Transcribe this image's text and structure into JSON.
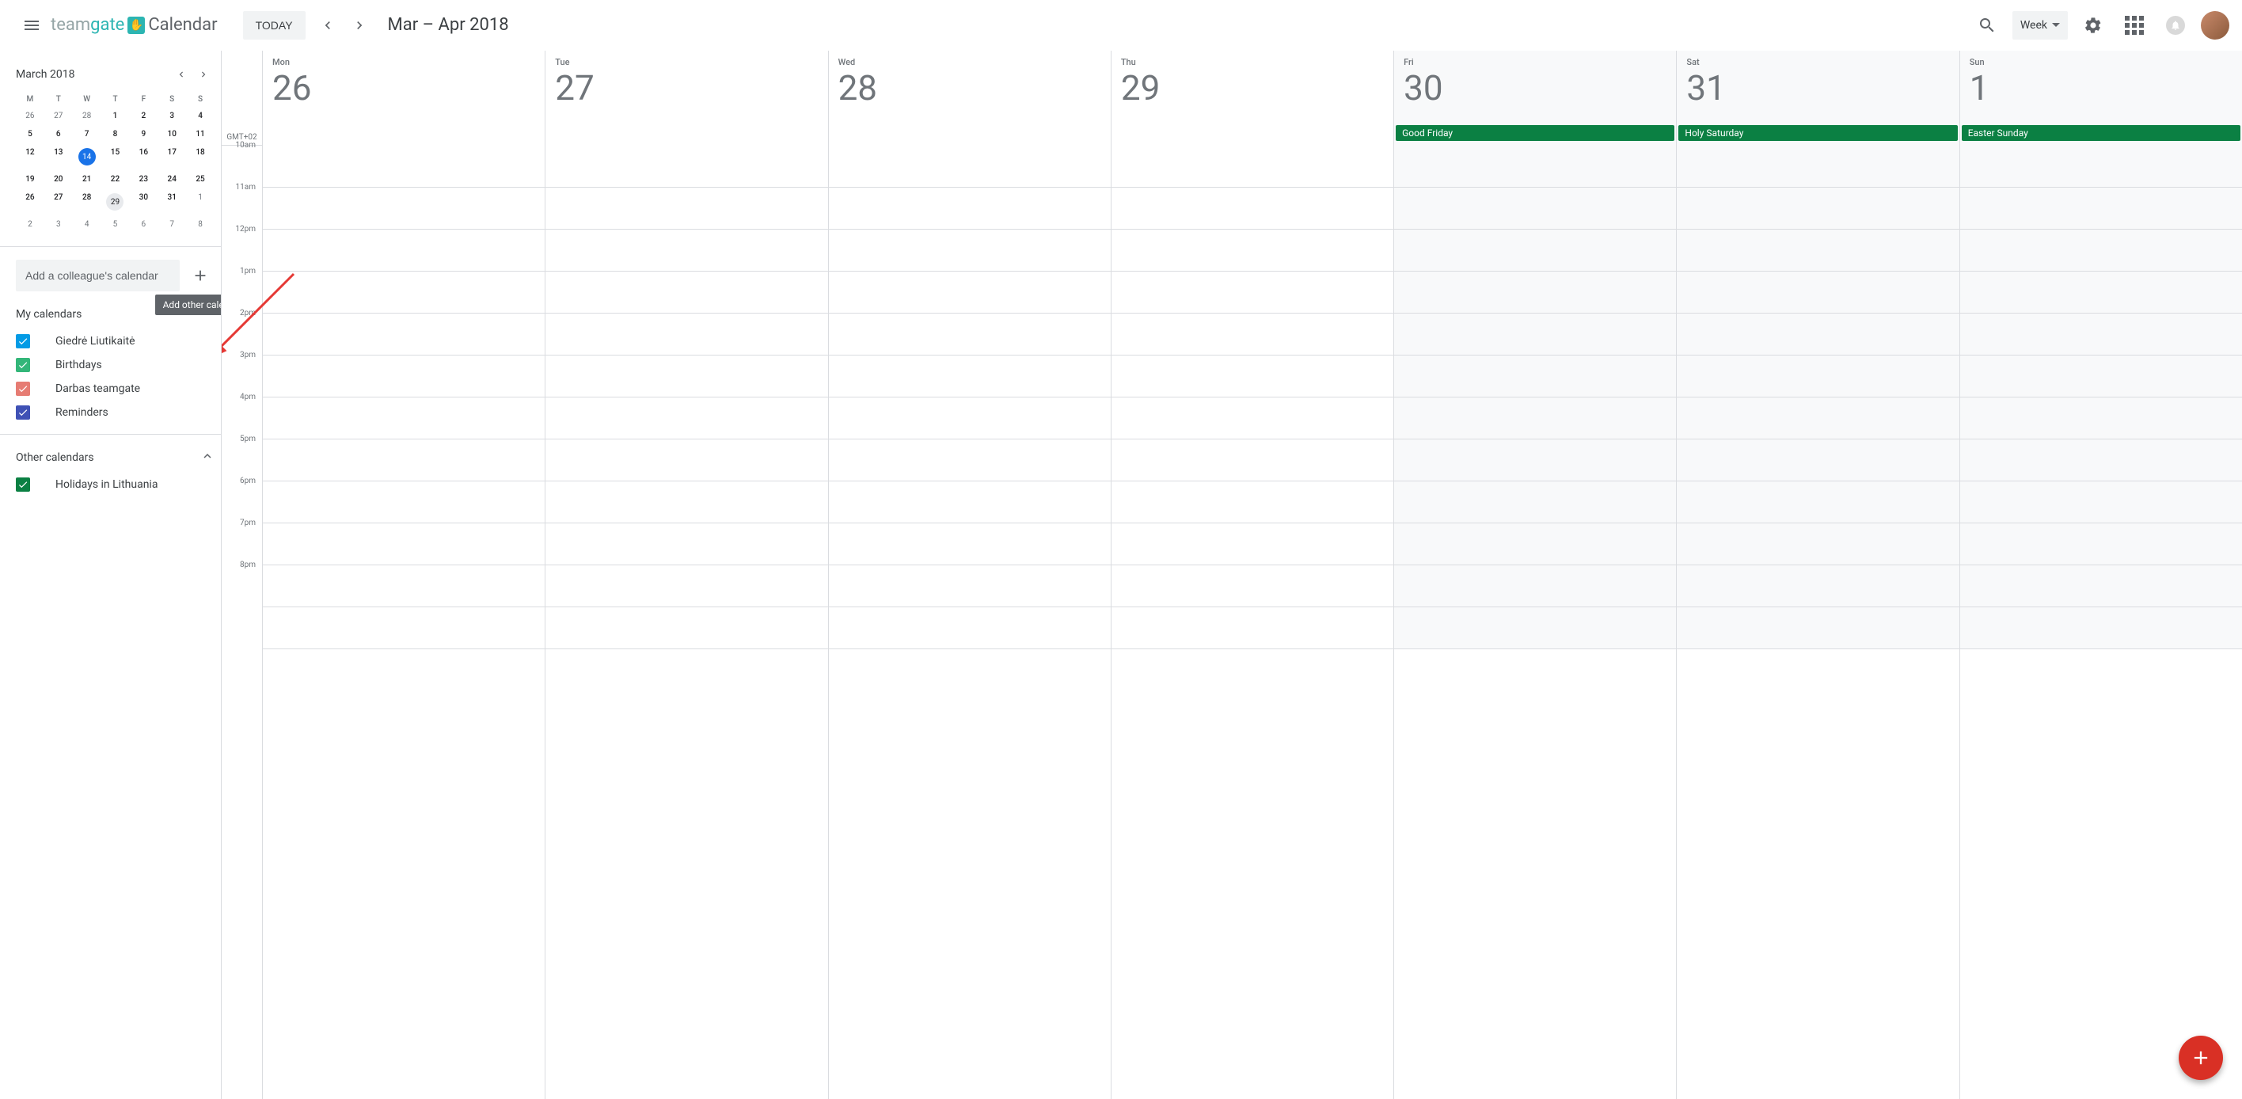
{
  "header": {
    "brand_team": "team",
    "brand_gate": "gate",
    "brand_cal": "Calendar",
    "today_label": "TODAY",
    "range_label": "Mar – Apr 2018",
    "view_label": "Week"
  },
  "mini": {
    "title": "March 2018",
    "dow": [
      "M",
      "T",
      "W",
      "T",
      "F",
      "S",
      "S"
    ],
    "weeks": [
      [
        {
          "n": "26",
          "dim": true
        },
        {
          "n": "27",
          "dim": true
        },
        {
          "n": "28",
          "dim": true
        },
        {
          "n": "1",
          "bold": true
        },
        {
          "n": "2",
          "bold": true
        },
        {
          "n": "3",
          "bold": true
        },
        {
          "n": "4",
          "bold": true
        }
      ],
      [
        {
          "n": "5",
          "bold": true
        },
        {
          "n": "6",
          "bold": true
        },
        {
          "n": "7",
          "bold": true
        },
        {
          "n": "8",
          "bold": true
        },
        {
          "n": "9",
          "bold": true
        },
        {
          "n": "10",
          "bold": true
        },
        {
          "n": "11",
          "bold": true
        }
      ],
      [
        {
          "n": "12",
          "bold": true
        },
        {
          "n": "13",
          "bold": true
        },
        {
          "n": "14",
          "today": true
        },
        {
          "n": "15",
          "bold": true
        },
        {
          "n": "16",
          "bold": true
        },
        {
          "n": "17",
          "bold": true
        },
        {
          "n": "18",
          "bold": true
        }
      ],
      [
        {
          "n": "19",
          "bold": true
        },
        {
          "n": "20",
          "bold": true
        },
        {
          "n": "21",
          "bold": true
        },
        {
          "n": "22",
          "bold": true
        },
        {
          "n": "23",
          "bold": true
        },
        {
          "n": "24",
          "bold": true
        },
        {
          "n": "25",
          "bold": true
        }
      ],
      [
        {
          "n": "26",
          "bold": true
        },
        {
          "n": "27",
          "bold": true
        },
        {
          "n": "28",
          "bold": true
        },
        {
          "n": "29",
          "selected": true
        },
        {
          "n": "30",
          "bold": true
        },
        {
          "n": "31",
          "bold": true
        },
        {
          "n": "1",
          "dim": true
        }
      ],
      [
        {
          "n": "2",
          "dim": true
        },
        {
          "n": "3",
          "dim": true
        },
        {
          "n": "4",
          "dim": true
        },
        {
          "n": "5",
          "dim": true
        },
        {
          "n": "6",
          "dim": true
        },
        {
          "n": "7",
          "dim": true
        },
        {
          "n": "8",
          "dim": true
        }
      ]
    ]
  },
  "add_colleague_placeholder": "Add a colleague's calendar",
  "tooltip_add_other": "Add other calendars",
  "sections": {
    "my_calendars": {
      "title": "My calendars",
      "items": [
        {
          "label": "Giedrė Liutikaitė",
          "color": "#039be5"
        },
        {
          "label": "Birthdays",
          "color": "#33b679"
        },
        {
          "label": "Darbas teamgate",
          "color": "#e67c73"
        },
        {
          "label": "Reminders",
          "color": "#3f51b5"
        }
      ]
    },
    "other_calendars": {
      "title": "Other calendars",
      "items": [
        {
          "label": "Holidays in Lithuania",
          "color": "#0b8043"
        }
      ]
    }
  },
  "timezone_label": "GMT+02",
  "hours": [
    "10am",
    "11am",
    "12pm",
    "1pm",
    "2pm",
    "3pm",
    "4pm",
    "5pm",
    "6pm",
    "7pm",
    "8pm"
  ],
  "days": [
    {
      "dow": "Mon",
      "num": "26",
      "weekend": false,
      "events": []
    },
    {
      "dow": "Tue",
      "num": "27",
      "weekend": false,
      "events": []
    },
    {
      "dow": "Wed",
      "num": "28",
      "weekend": false,
      "events": []
    },
    {
      "dow": "Thu",
      "num": "29",
      "weekend": false,
      "events": []
    },
    {
      "dow": "Fri",
      "num": "30",
      "weekend": true,
      "events": [
        {
          "title": "Good Friday"
        }
      ]
    },
    {
      "dow": "Sat",
      "num": "31",
      "weekend": true,
      "events": [
        {
          "title": "Holy Saturday"
        }
      ]
    },
    {
      "dow": "Sun",
      "num": "1",
      "weekend": true,
      "events": [
        {
          "title": "Easter Sunday"
        }
      ]
    }
  ]
}
